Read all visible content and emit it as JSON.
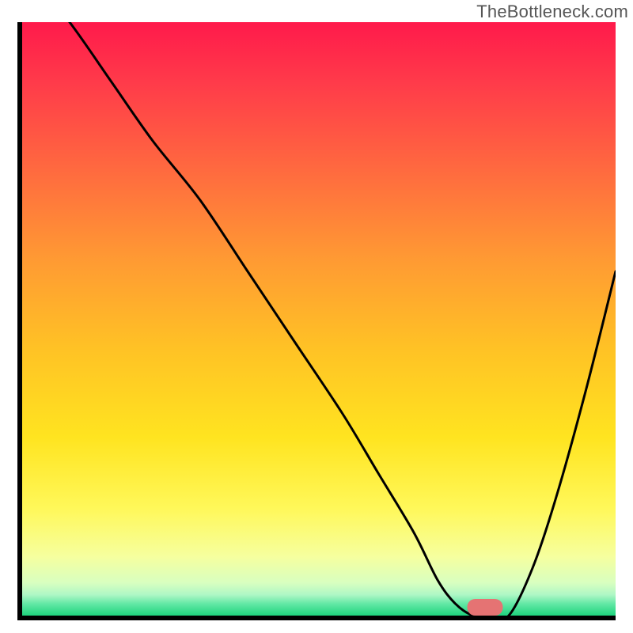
{
  "watermark": "TheBottleneck.com",
  "colors": {
    "curve": "#000000",
    "marker": "#e57373",
    "axes": "#000000"
  },
  "chart_data": {
    "type": "line",
    "title": "",
    "xlabel": "",
    "ylabel": "",
    "xlim": [
      0,
      100
    ],
    "ylim": [
      0,
      100
    ],
    "x": [
      0,
      8,
      15,
      22,
      30,
      38,
      46,
      54,
      60,
      66,
      70,
      73,
      76,
      79,
      82,
      86,
      90,
      95,
      100
    ],
    "values": [
      110,
      100,
      90,
      80,
      70,
      58,
      46,
      34,
      24,
      14,
      6,
      2,
      0,
      0,
      0,
      8,
      20,
      38,
      58
    ],
    "marker": {
      "x_start": 75,
      "x_end": 81,
      "y": 0,
      "height": 2.8
    },
    "gradient_stops": [
      {
        "pos": 0.0,
        "color": "#ff1a4b"
      },
      {
        "pos": 0.55,
        "color": "#ffc225"
      },
      {
        "pos": 1.0,
        "color": "#1fd47e"
      }
    ]
  }
}
